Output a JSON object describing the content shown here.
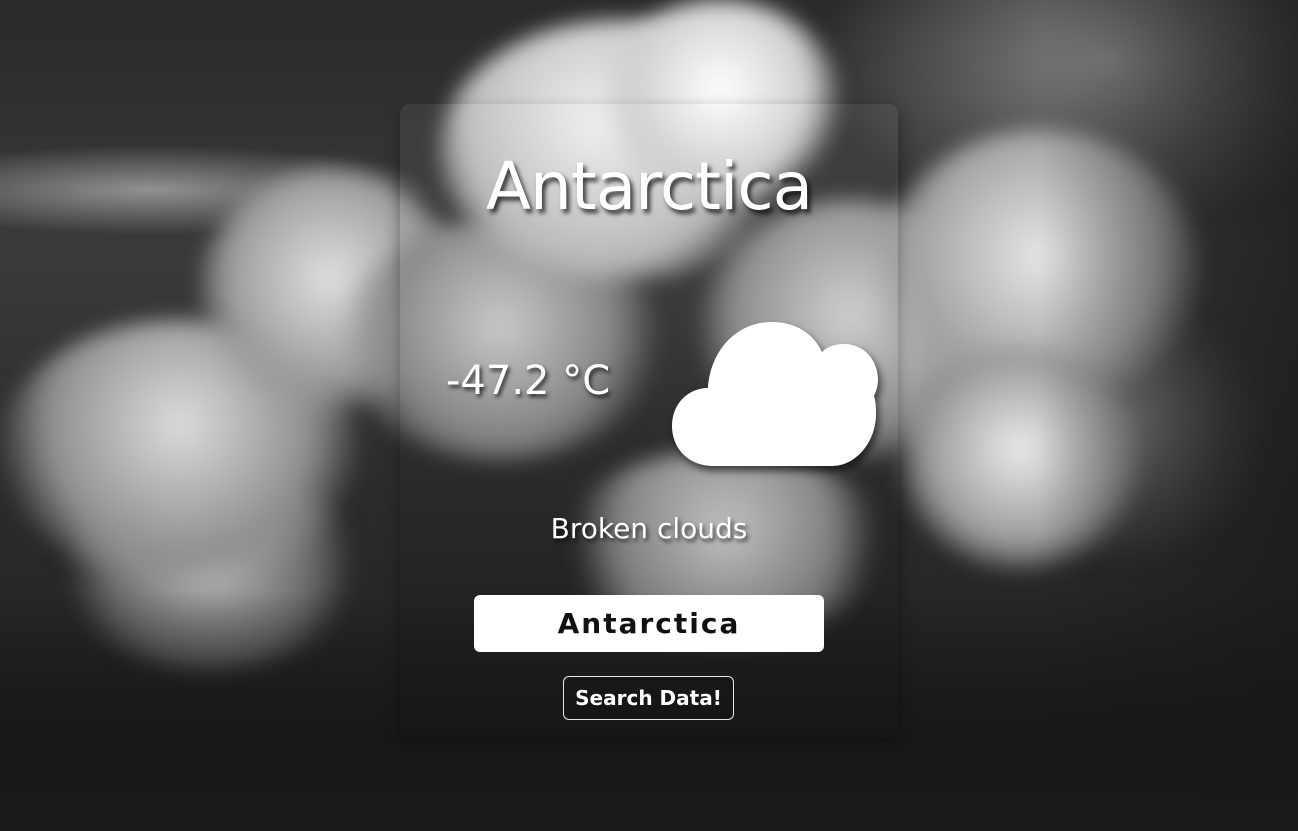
{
  "weather": {
    "city": "Antarctica",
    "temperature": "-47.2 °C",
    "description": "Broken clouds",
    "icon": "cloud-icon"
  },
  "search": {
    "value": "Antarctica",
    "button_label": "Search Data!"
  },
  "colors": {
    "text": "#ffffff",
    "input_background": "#ffffff",
    "input_text": "#111111",
    "button_border": "#e6e6e6"
  }
}
